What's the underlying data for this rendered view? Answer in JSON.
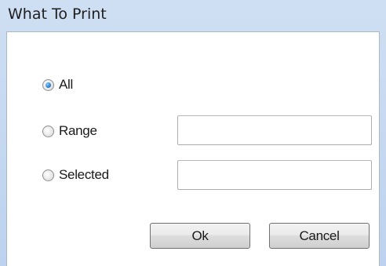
{
  "window": {
    "title": "What To Print"
  },
  "options": {
    "all_label": "All",
    "range_label": "Range",
    "selected_label": "Selected",
    "checked": "All"
  },
  "inputs": {
    "range_value": "",
    "selected_value": ""
  },
  "buttons": {
    "ok_label": "Ok",
    "cancel_label": "Cancel"
  }
}
